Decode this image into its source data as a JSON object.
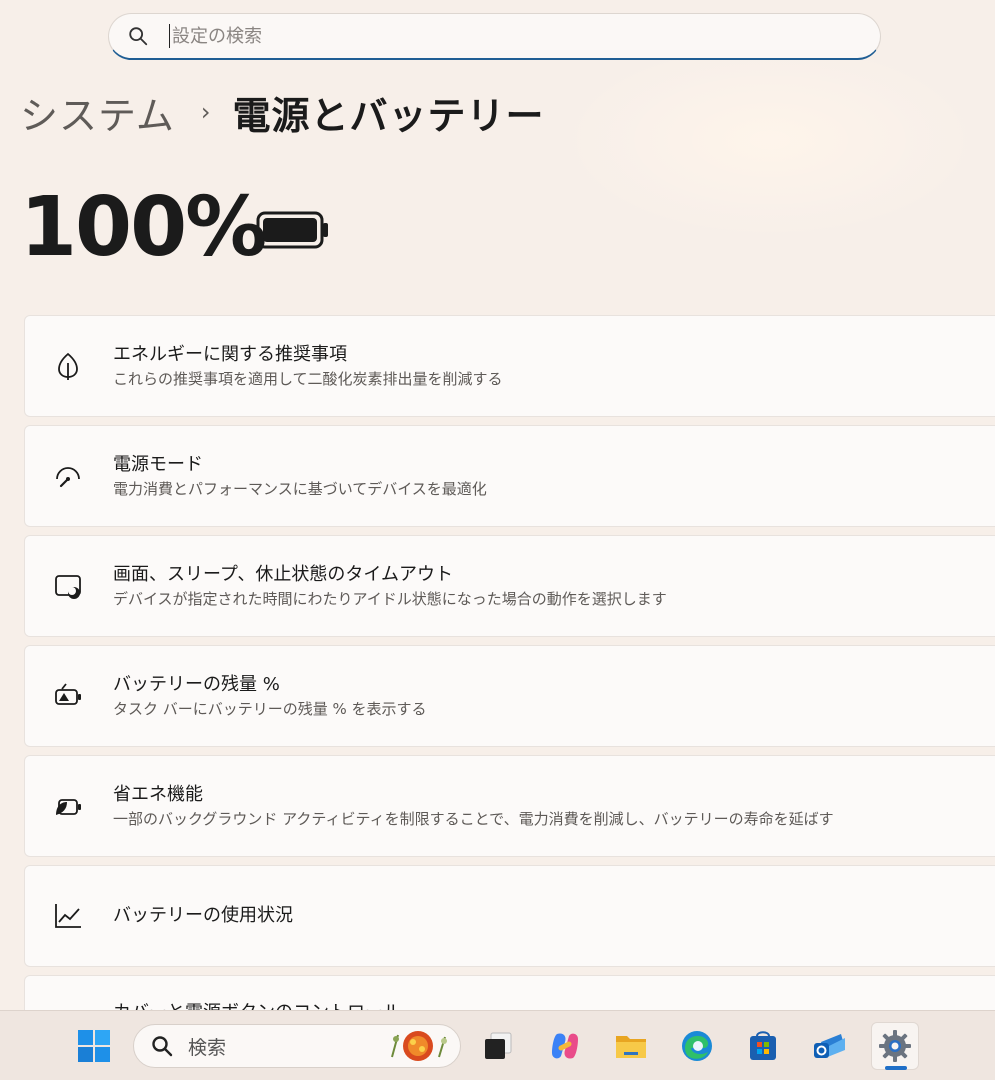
{
  "search": {
    "placeholder": "設定の検索"
  },
  "breadcrumb": {
    "parent": "システム",
    "separator": "›",
    "current": "電源とバッテリー"
  },
  "battery": {
    "percent_label": "100%",
    "level": 1.0
  },
  "cards": [
    {
      "icon": "leaf-icon",
      "title": "エネルギーに関する推奨事項",
      "subtitle": "これらの推奨事項を適用して二酸化炭素排出量を削減する"
    },
    {
      "icon": "power-mode-gauge-icon",
      "title": "電源モード",
      "subtitle": "電力消費とパフォーマンスに基づいてデバイスを最適化"
    },
    {
      "icon": "screen-sleep-icon",
      "title": "画面、スリープ、休止状態のタイムアウト",
      "subtitle": "デバイスが指定された時間にわたりアイドル状態になった場合の動作を選択します"
    },
    {
      "icon": "battery-percent-icon",
      "title": "バッテリーの残量 %",
      "subtitle": "タスク バーにバッテリーの残量 % を表示する"
    },
    {
      "icon": "energy-saver-icon",
      "title": "省エネ機能",
      "subtitle": "一部のバックグラウンド アクティビティを制限することで、電力消費を削減し、バッテリーの寿命を延ばす"
    },
    {
      "icon": "usage-chart-icon",
      "title": "バッテリーの使用状況",
      "subtitle": ""
    },
    {
      "icon": "",
      "title": "カバーと電源ボタンのコントロール",
      "subtitle": ""
    }
  ],
  "taskbar": {
    "search_label": "検索",
    "items": [
      "windows-start-icon",
      "task-view-icon",
      "copilot-icon",
      "file-explorer-icon",
      "edge-icon",
      "store-icon",
      "outlook-icon",
      "settings-icon"
    ],
    "accent": "#1f6fc7"
  }
}
